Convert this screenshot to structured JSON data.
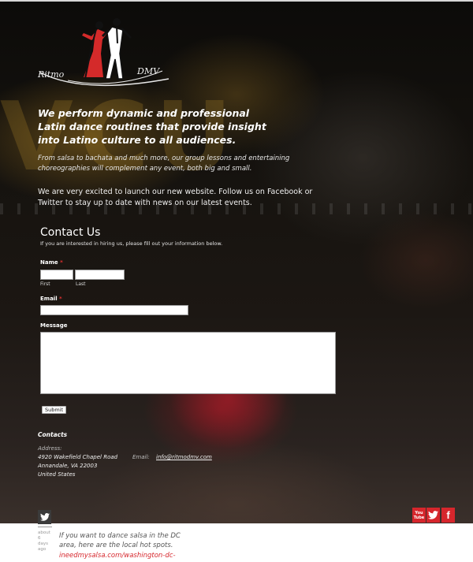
{
  "brand": {
    "logo_text_left": "Ritmo",
    "logo_text_right": "DMV"
  },
  "hero": {
    "tagline": "We perform dynamic and professional Latin dance routines that provide insight into Latino culture to all audiences.",
    "subtagline": "From salsa to bachata and much more, our group lessons and entertaining choreographies will complement any event, both big and small.",
    "announcement": "We are very excited to launch our new website. Follow us on Facebook or Twitter to stay up to date with news on our latest events."
  },
  "contact_form": {
    "title": "Contact Us",
    "intro": "If you are interested in hiring us, please fill out your information below.",
    "name_label": "Name",
    "required_mark": "*",
    "first_label": "First",
    "last_label": "Last",
    "email_label": "Email",
    "message_label": "Message",
    "submit_label": "Submit",
    "first_value": "",
    "last_value": "",
    "email_value": "",
    "message_value": ""
  },
  "contacts": {
    "title": "Contacts",
    "address_label": "Address:",
    "address_lines": [
      "4920 Wakefield Chapel Road",
      "Annandale, VA 22003",
      "United States"
    ],
    "email_label": "Email:",
    "email_value": "info@ritmodmv.com"
  },
  "social": {
    "youtube": "You Tube",
    "twitter_icon": "twitter-bird-icon",
    "facebook": "f",
    "color": "#d6262c"
  },
  "twitter_feed": {
    "time": "about 6 days ago",
    "text": "If you want to dance salsa in the DC area, here are the local hot spots.",
    "link": "ineedmysalsa.com/washington-dc-"
  }
}
